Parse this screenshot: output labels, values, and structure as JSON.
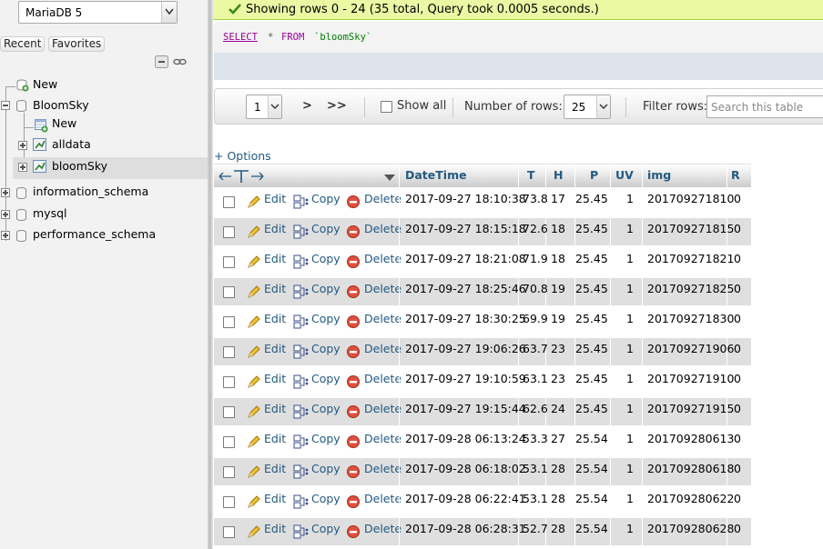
{
  "sidebar": {
    "server_select": "MariaDB 5",
    "tabs": [
      "Recent",
      "Favorites"
    ],
    "tree": [
      {
        "label": "New"
      },
      {
        "label": "BloomSky"
      },
      {
        "label": "New"
      },
      {
        "label": "alldata"
      },
      {
        "label": "bloomSky"
      },
      {
        "label": "information_schema"
      },
      {
        "label": "mysql"
      },
      {
        "label": "performance_schema"
      }
    ]
  },
  "main": {
    "success_message": "Showing rows 0 - 24 (35 total, Query took 0.0005 seconds.)",
    "sql": {
      "keyword1": "SELECT",
      "star": "*",
      "keyword2": "FROM",
      "table": "`bloomSky`"
    },
    "navbar": {
      "page_value": "1",
      "next_label": ">",
      "last_label": ">>",
      "show_all_label": "Show all",
      "num_rows_label": "Number of rows:",
      "num_rows_value": "25",
      "filter_label": "Filter rows:",
      "search_placeholder": "Search this table"
    },
    "options_label": "+ Options",
    "table": {
      "columns": [
        "DateTime",
        "T",
        "H",
        "P",
        "UV",
        "img",
        "R"
      ],
      "action_labels": {
        "edit": "Edit",
        "copy": "Copy",
        "delete": "Delete"
      },
      "rows": [
        [
          "2017-09-27 18:10:38",
          "73.8",
          "17",
          "25.45",
          "1",
          "201709271810",
          "0"
        ],
        [
          "2017-09-27 18:15:18",
          "72.6",
          "18",
          "25.45",
          "1",
          "201709271815",
          "0"
        ],
        [
          "2017-09-27 18:21:08",
          "71.9",
          "18",
          "25.45",
          "1",
          "201709271821",
          "0"
        ],
        [
          "2017-09-27 18:25:46",
          "70.8",
          "19",
          "25.45",
          "1",
          "201709271825",
          "0"
        ],
        [
          "2017-09-27 18:30:25",
          "69.9",
          "19",
          "25.45",
          "1",
          "201709271830",
          "0"
        ],
        [
          "2017-09-27 19:06:26",
          "63.7",
          "23",
          "25.45",
          "1",
          "201709271906",
          "0"
        ],
        [
          "2017-09-27 19:10:59",
          "63.1",
          "23",
          "25.45",
          "1",
          "201709271910",
          "0"
        ],
        [
          "2017-09-27 19:15:44",
          "62.6",
          "24",
          "25.45",
          "1",
          "201709271915",
          "0"
        ],
        [
          "2017-09-28 06:13:24",
          "53.3",
          "27",
          "25.54",
          "1",
          "201709280613",
          "0"
        ],
        [
          "2017-09-28 06:18:02",
          "53.1",
          "28",
          "25.54",
          "1",
          "201709280618",
          "0"
        ],
        [
          "2017-09-28 06:22:41",
          "53.1",
          "28",
          "25.54",
          "1",
          "201709280622",
          "0"
        ],
        [
          "2017-09-28 06:28:31",
          "52.7",
          "28",
          "25.54",
          "1",
          "201709280628",
          "0"
        ]
      ]
    }
  },
  "colors": {
    "link": "#235a81",
    "success_bg": "#ebf8a4",
    "row_alt": "#dfdfdf"
  }
}
